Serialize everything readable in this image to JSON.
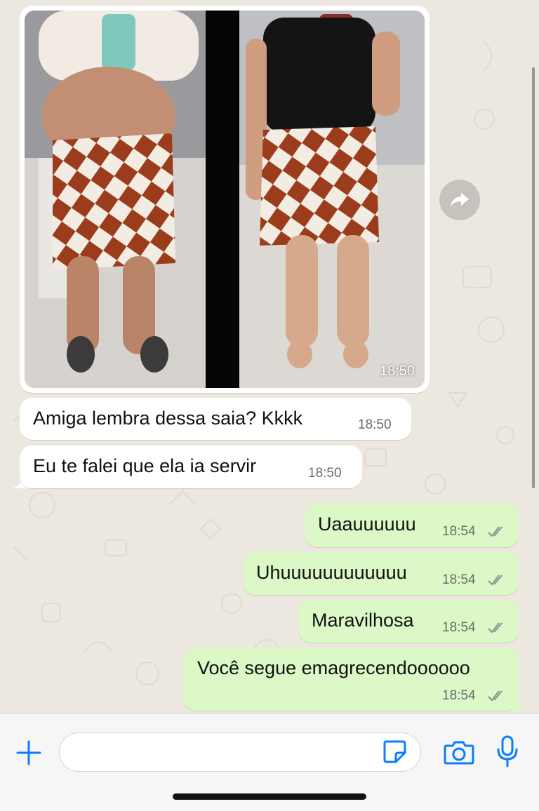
{
  "chat": {
    "image_message": {
      "time": "18:50"
    },
    "incoming": [
      {
        "text": "Amiga lembra dessa saia? Kkkk",
        "time": "18:50"
      },
      {
        "text": "Eu te falei que ela ia servir",
        "time": "18:50"
      }
    ],
    "outgoing": [
      {
        "text": "Uaauuuuuu",
        "time": "18:54"
      },
      {
        "text": "Uhuuuuuuuuuuuu",
        "time": "18:54"
      },
      {
        "text": "Maravilhosa",
        "time": "18:54"
      },
      {
        "text": "Você segue emagrecendoooooo",
        "time": "18:54"
      }
    ]
  },
  "composer": {
    "placeholder": "",
    "icons": [
      "plus-icon",
      "sticker-icon",
      "camera-icon",
      "mic-icon"
    ]
  },
  "colors": {
    "outgoing_bubble": "#dcf8c6",
    "incoming_bubble": "#ffffff",
    "accent": "#0a7cff",
    "read_ticks": "#8c8c8c"
  }
}
